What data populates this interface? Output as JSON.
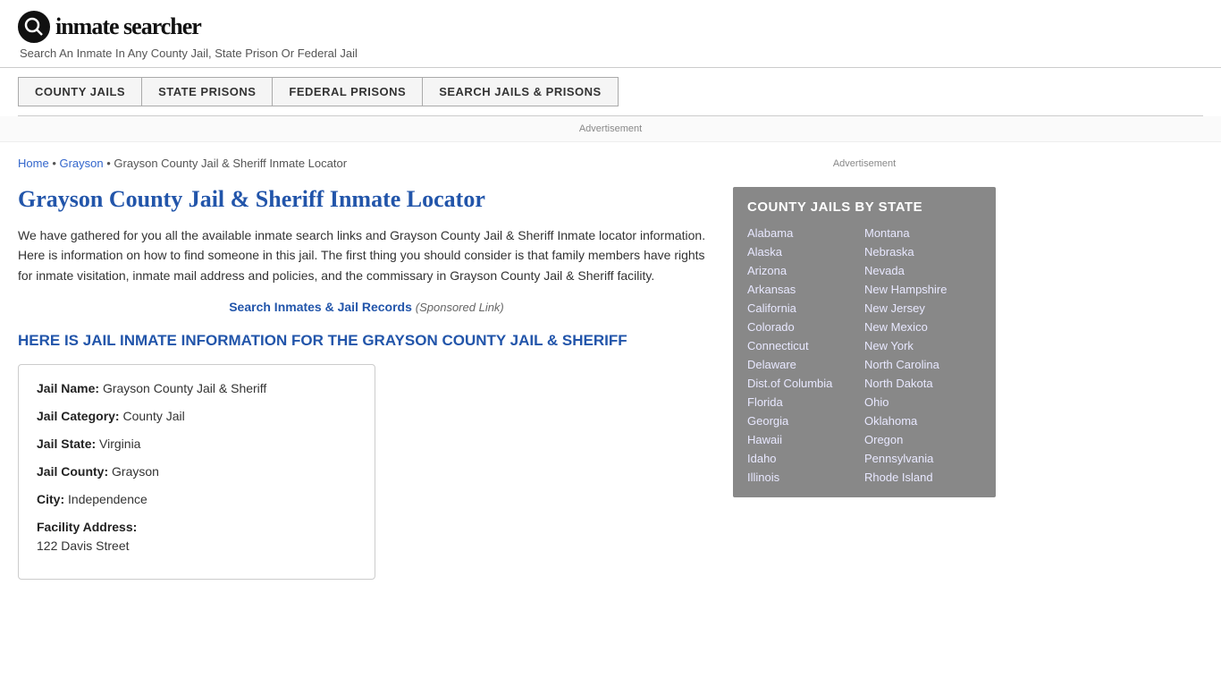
{
  "header": {
    "logo_icon": "Q",
    "logo_text": "inmate searcher",
    "tagline": "Search An Inmate In Any County Jail, State Prison Or Federal Jail"
  },
  "nav": {
    "buttons": [
      "COUNTY JAILS",
      "STATE PRISONS",
      "FEDERAL PRISONS",
      "SEARCH JAILS & PRISONS"
    ]
  },
  "ad": {
    "label": "Advertisement"
  },
  "breadcrumb": {
    "home": "Home",
    "parent": "Grayson",
    "current": "Grayson County Jail & Sheriff Inmate Locator"
  },
  "page": {
    "title": "Grayson County Jail & Sheriff Inmate Locator",
    "description": "We have gathered for you all the available inmate search links and Grayson County Jail & Sheriff Inmate locator information. Here is information on how to find someone in this jail. The first thing you should consider is that family members have rights for inmate visitation, inmate mail address and policies, and the commissary in Grayson County Jail & Sheriff facility.",
    "sponsored_link_text": "Search Inmates & Jail Records",
    "sponsored_label": "(Sponsored Link)",
    "section_heading": "HERE IS JAIL INMATE INFORMATION FOR THE GRAYSON COUNTY JAIL & SHERIFF"
  },
  "info_card": {
    "jail_name_label": "Jail Name:",
    "jail_name_value": "Grayson County Jail & Sheriff",
    "jail_category_label": "Jail Category:",
    "jail_category_value": "County Jail",
    "jail_state_label": "Jail State:",
    "jail_state_value": "Virginia",
    "jail_county_label": "Jail County:",
    "jail_county_value": "Grayson",
    "city_label": "City:",
    "city_value": "Independence",
    "facility_address_label": "Facility Address:",
    "facility_address_value": "122 Davis Street"
  },
  "sidebar": {
    "ad_label": "Advertisement",
    "state_box_title": "COUNTY JAILS BY STATE",
    "states_left": [
      "Alabama",
      "Alaska",
      "Arizona",
      "Arkansas",
      "California",
      "Colorado",
      "Connecticut",
      "Delaware",
      "Dist.of Columbia",
      "Florida",
      "Georgia",
      "Hawaii",
      "Idaho",
      "Illinois"
    ],
    "states_right": [
      "Montana",
      "Nebraska",
      "Nevada",
      "New Hampshire",
      "New Jersey",
      "New Mexico",
      "New York",
      "North Carolina",
      "North Dakota",
      "Ohio",
      "Oklahoma",
      "Oregon",
      "Pennsylvania",
      "Rhode Island"
    ]
  }
}
